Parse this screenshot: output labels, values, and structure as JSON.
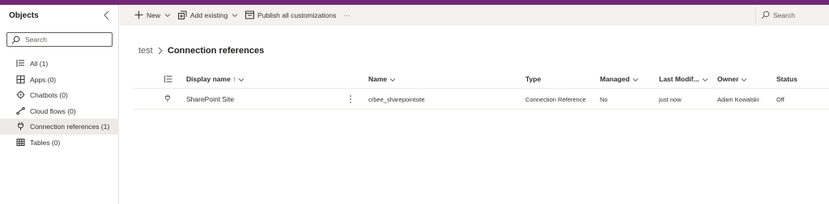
{
  "colors": {
    "top_accent": "#742774",
    "command_bar_bg": "#f3f2f1",
    "active_item_bg": "#edebe9"
  },
  "sidebar": {
    "title": "Objects",
    "search_placeholder": "Search",
    "items": [
      {
        "label": "All (1)",
        "icon": "list-icon"
      },
      {
        "label": "Apps (0)",
        "icon": "apps-icon"
      },
      {
        "label": "Chatbots (0)",
        "icon": "chatbot-icon"
      },
      {
        "label": "Cloud flows (0)",
        "icon": "flow-icon"
      },
      {
        "label": "Connection references (1)",
        "icon": "plug-icon",
        "active": true
      },
      {
        "label": "Tables (0)",
        "icon": "table-icon"
      }
    ]
  },
  "commandbar": {
    "new_label": "New",
    "add_existing_label": "Add existing",
    "publish_label": "Publish all customizations",
    "more_label": "···",
    "search_label": "Search"
  },
  "breadcrumb": {
    "root": "test",
    "current": "Connection references"
  },
  "grid": {
    "columns": {
      "display_name": "Display name ↑",
      "name": "Name",
      "type": "Type",
      "managed": "Managed",
      "last_modified": "Last Modif...",
      "owner": "Owner",
      "status": "Status"
    },
    "rows": [
      {
        "display_name": "SharePoint Site",
        "name": "crbee_sharepointsite",
        "type": "Connection Reference",
        "managed": "No",
        "last_modified": "just now",
        "owner": "Adam Kowalski",
        "status": "Off"
      }
    ]
  }
}
